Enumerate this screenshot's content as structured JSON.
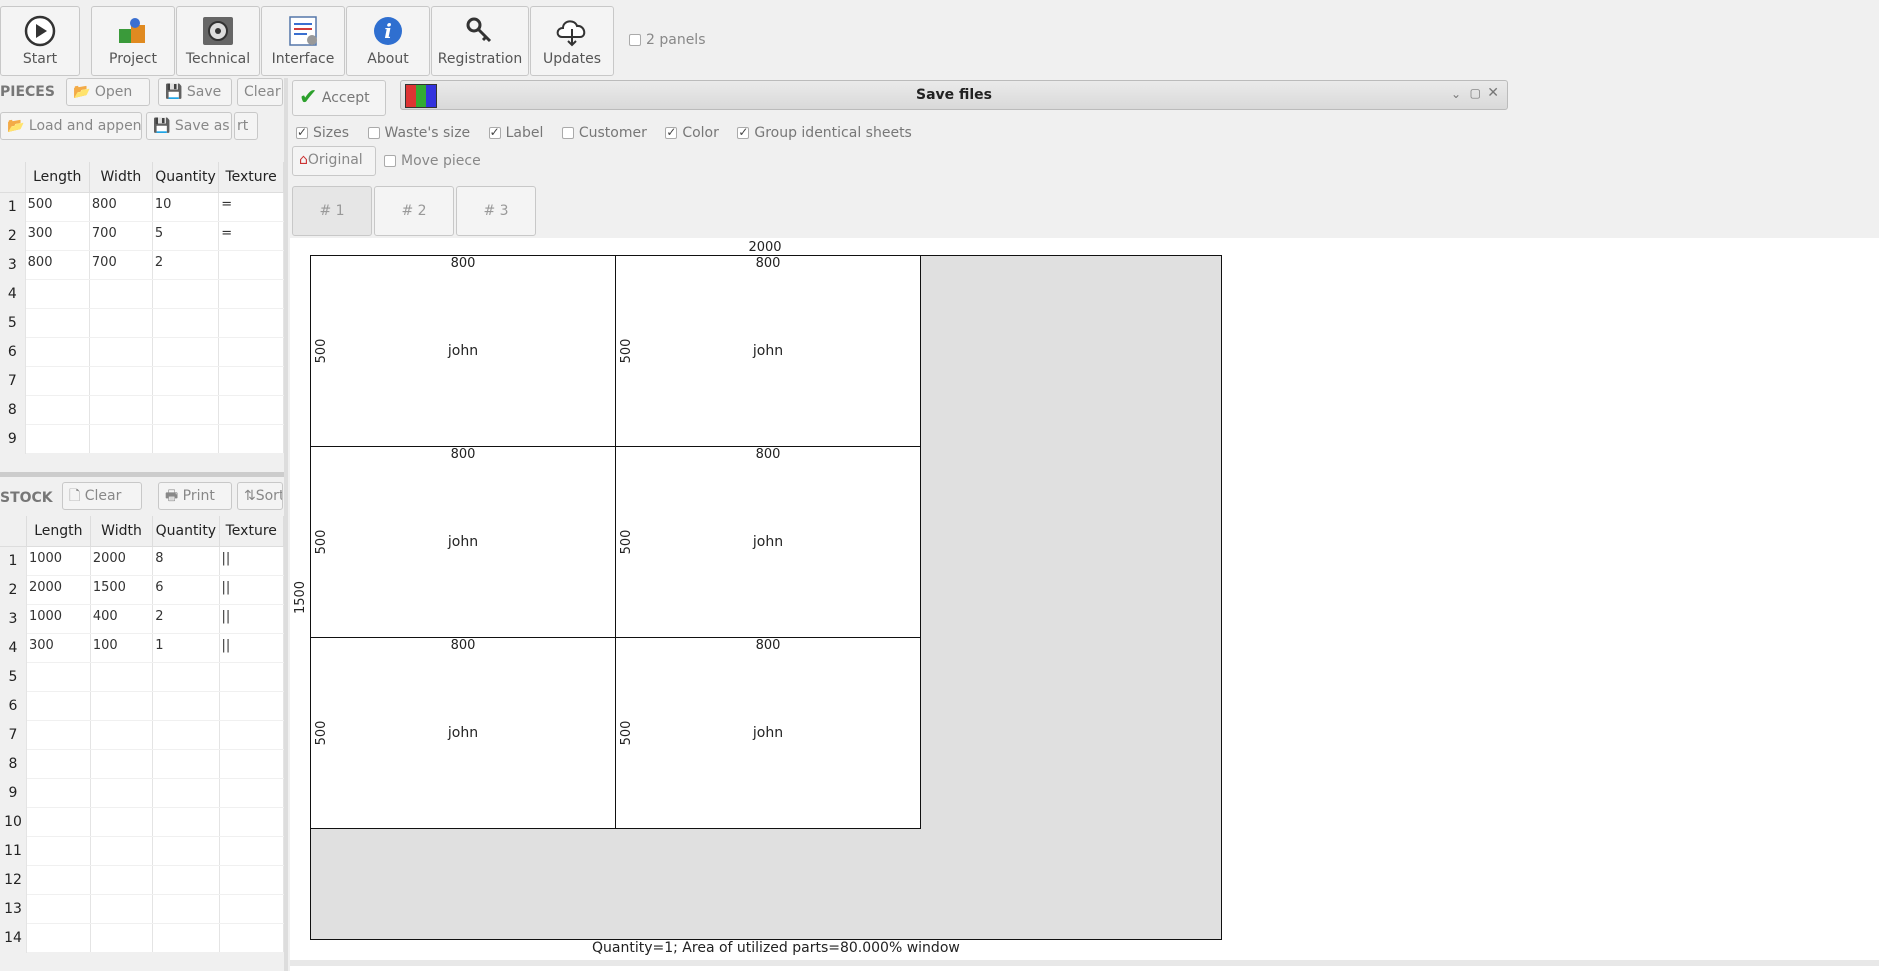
{
  "toolbar": {
    "start": "Start",
    "project": "Project",
    "technical": "Technical",
    "interface": "Interface",
    "about": "About",
    "registration": "Registration",
    "updates": "Updates",
    "two_panels": "2 panels"
  },
  "pieces": {
    "title": "PIECES",
    "open": "Open",
    "save": "Save",
    "clear": "Clear",
    "load_append": "Load and append",
    "save_as": "Save as",
    "sort_partial": "rt",
    "columns": [
      "Length",
      "Width",
      "Quantity",
      "Texture"
    ],
    "rows": [
      {
        "n": "1",
        "length": "500",
        "width": "800",
        "qty": "10",
        "texture": "="
      },
      {
        "n": "2",
        "length": "300",
        "width": "700",
        "qty": "5",
        "texture": "="
      },
      {
        "n": "3",
        "length": "800",
        "width": "700",
        "qty": "2",
        "texture": ""
      },
      {
        "n": "4",
        "length": "",
        "width": "",
        "qty": "",
        "texture": ""
      },
      {
        "n": "5",
        "length": "",
        "width": "",
        "qty": "",
        "texture": ""
      },
      {
        "n": "6",
        "length": "",
        "width": "",
        "qty": "",
        "texture": ""
      },
      {
        "n": "7",
        "length": "",
        "width": "",
        "qty": "",
        "texture": ""
      },
      {
        "n": "8",
        "length": "",
        "width": "",
        "qty": "",
        "texture": ""
      },
      {
        "n": "9",
        "length": "",
        "width": "",
        "qty": "",
        "texture": ""
      }
    ]
  },
  "stock": {
    "title": "STOCK",
    "clear": "Clear",
    "print": "Print",
    "sort": "Sort",
    "columns": [
      "Length",
      "Width",
      "Quantity",
      "Texture"
    ],
    "rows": [
      {
        "n": "1",
        "length": "1000",
        "width": "2000",
        "qty": "8",
        "texture": "||"
      },
      {
        "n": "2",
        "length": "2000",
        "width": "1500",
        "qty": "6",
        "texture": "||"
      },
      {
        "n": "3",
        "length": "1000",
        "width": "400",
        "qty": "2",
        "texture": "||"
      },
      {
        "n": "4",
        "length": "300",
        "width": "100",
        "qty": "1",
        "texture": "||"
      },
      {
        "n": "5",
        "length": "",
        "width": "",
        "qty": "",
        "texture": ""
      },
      {
        "n": "6",
        "length": "",
        "width": "",
        "qty": "",
        "texture": ""
      },
      {
        "n": "7",
        "length": "",
        "width": "",
        "qty": "",
        "texture": ""
      },
      {
        "n": "8",
        "length": "",
        "width": "",
        "qty": "",
        "texture": ""
      },
      {
        "n": "9",
        "length": "",
        "width": "",
        "qty": "",
        "texture": ""
      },
      {
        "n": "10",
        "length": "",
        "width": "",
        "qty": "",
        "texture": ""
      },
      {
        "n": "11",
        "length": "",
        "width": "",
        "qty": "",
        "texture": ""
      },
      {
        "n": "12",
        "length": "",
        "width": "",
        "qty": "",
        "texture": ""
      },
      {
        "n": "13",
        "length": "",
        "width": "",
        "qty": "",
        "texture": ""
      },
      {
        "n": "14",
        "length": "",
        "width": "",
        "qty": "",
        "texture": ""
      }
    ]
  },
  "result": {
    "accept": "Accept",
    "dialog_title": "Save files",
    "options": {
      "sizes": "Sizes",
      "waste_size": "Waste's size",
      "label": "Label",
      "customer": "Customer",
      "color": "Color",
      "group_identical": "Group identical sheets",
      "original": "Original",
      "move_piece": "Move piece"
    },
    "sheet_tabs": [
      "# 1",
      "# 2",
      "# 3"
    ],
    "sheet_width": "2000",
    "sheet_height": "1500",
    "pieces": [
      {
        "w": "800",
        "h": "500",
        "label": "john"
      },
      {
        "w": "800",
        "h": "500",
        "label": "john"
      },
      {
        "w": "800",
        "h": "500",
        "label": "john"
      },
      {
        "w": "800",
        "h": "500",
        "label": "john"
      },
      {
        "w": "800",
        "h": "500",
        "label": "john"
      },
      {
        "w": "800",
        "h": "500",
        "label": "john"
      }
    ],
    "footer": "Quantity=1; Area of utilized parts=80.000%  window"
  }
}
